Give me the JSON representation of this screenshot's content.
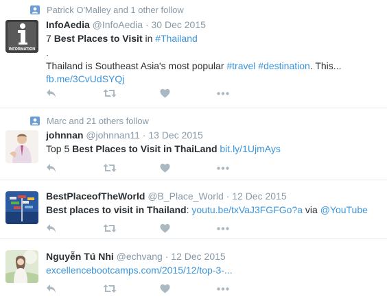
{
  "tweets": [
    {
      "context": "Patrick O'Malley and 1 other follow",
      "fullname": "InfoAedia",
      "screen_name": "@InfoAedia",
      "dot": "·",
      "date": "30 Dec 2015",
      "line1": {
        "a": "7 ",
        "b": "Best Places to Visit",
        "c": " in ",
        "tag": "#Thailand"
      },
      "line2": ".",
      "line3": {
        "a": "Thailand is Southeast Asia's most popular ",
        "tag1": "#travel",
        "sp": " ",
        "tag2": "#destination",
        "c": ". This..."
      },
      "line4": "fb.me/3CvUdSYQj",
      "avatar_label": "INFORMATION"
    },
    {
      "context": "Marc and 21 others follow",
      "fullname": "johnnan",
      "screen_name": "@johnnan11",
      "dot": "·",
      "date": "13 Dec 2015",
      "line1": {
        "a": "Top 5 ",
        "b": "Best Places to Visit in ThaiLand",
        "sp": " ",
        "link": "bit.ly/1UjmAys"
      }
    },
    {
      "fullname": "BestPlaceofTheWorld",
      "screen_name": "@B_Place_World",
      "dot": "·",
      "date": "12 Dec 2015",
      "line1": {
        "b": "Best places to visit in Thailand",
        "a": ": ",
        "link": "youtu.be/txVaJ3FGFGo?a",
        "c": " via ",
        "mention": "@YouTube"
      }
    },
    {
      "fullname": "Nguyễn Tú Nhi",
      "screen_name": "@echvang",
      "dot": "·",
      "date": "12 Dec 2015",
      "line1": {
        "link": "excellencebootcamps.com/2015/12/top-3-..."
      }
    }
  ],
  "icons": [
    "user-follow-icon",
    "reply-icon",
    "retweet-icon",
    "like-icon",
    "more-icon"
  ],
  "colors": {
    "muted": "#8899a6",
    "link": "#3b94d9",
    "follow_icon": "#6a9dd3",
    "divider": "#e1e8ed",
    "icon": "#aab8c2"
  }
}
